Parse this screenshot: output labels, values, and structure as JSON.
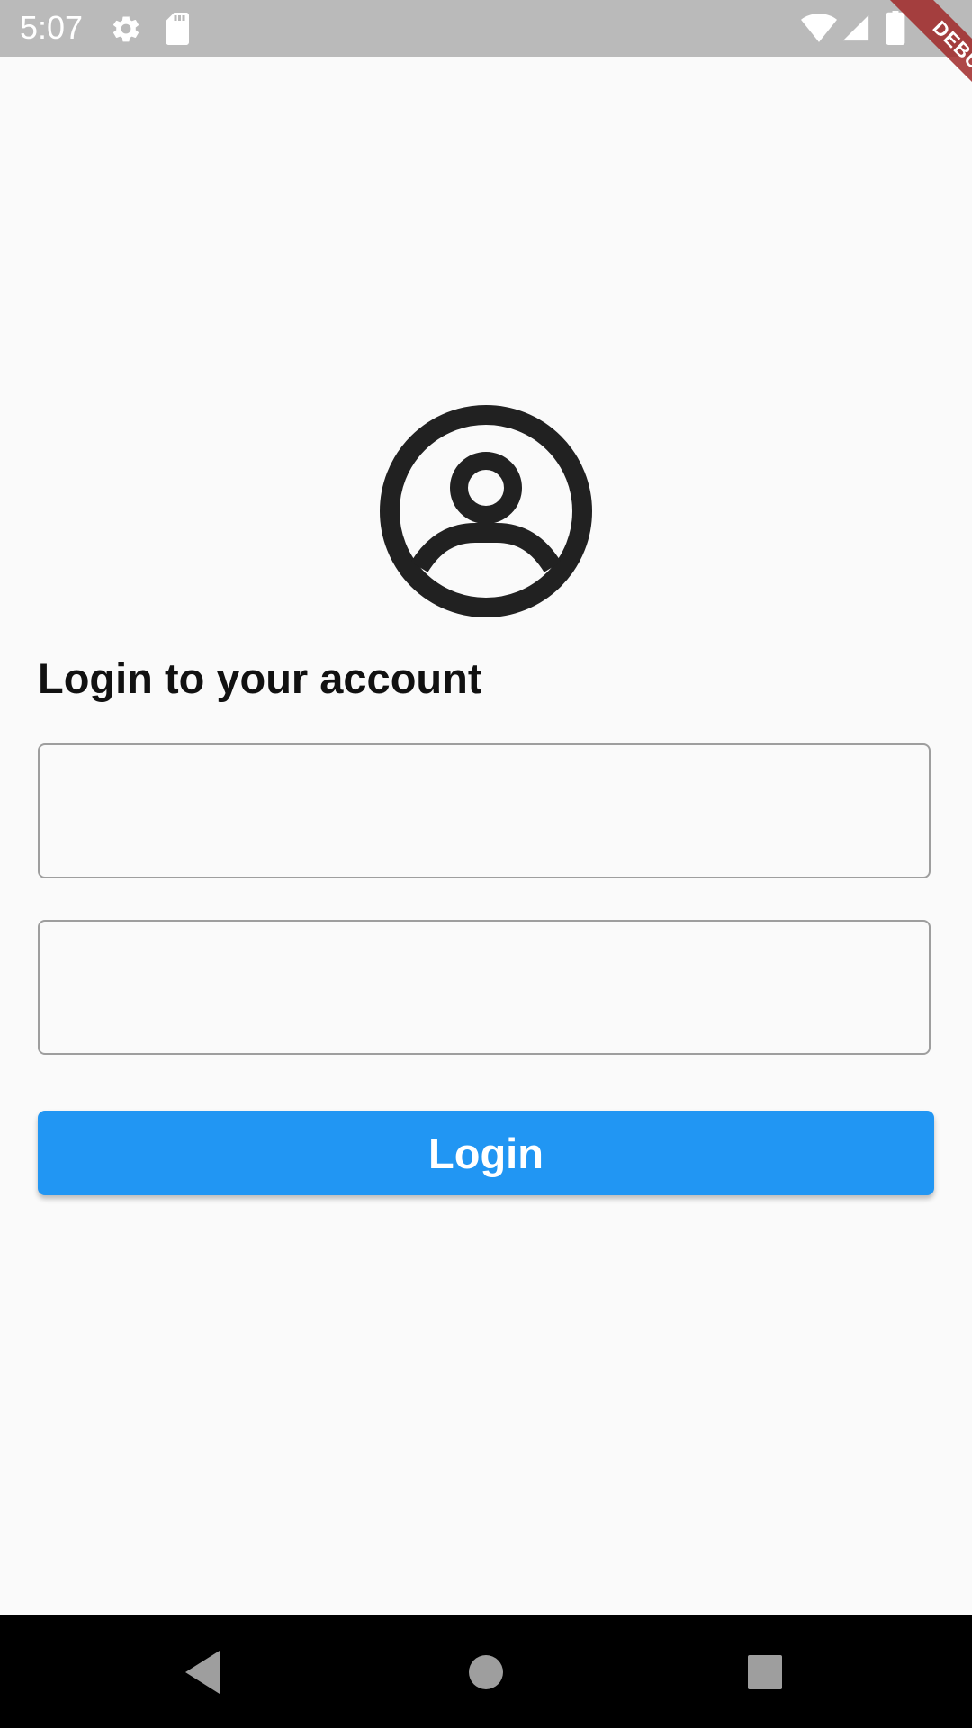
{
  "status_bar": {
    "time": "5:07",
    "icons": [
      "settings-icon",
      "sd-card-icon",
      "wifi-icon",
      "signal-icon",
      "battery-icon"
    ]
  },
  "debug_banner": {
    "label": "DEBUG"
  },
  "login": {
    "avatar_icon": "account-circle-icon",
    "title": "Login to your account",
    "username_value": "",
    "password_value": "",
    "button_label": "Login"
  },
  "nav_bar": {
    "buttons": [
      "back-icon",
      "home-icon",
      "recents-icon"
    ]
  },
  "colors": {
    "primary": "#2196f3",
    "background": "#fafafa",
    "status_bar": "#bababa",
    "nav_bar": "#000000"
  }
}
